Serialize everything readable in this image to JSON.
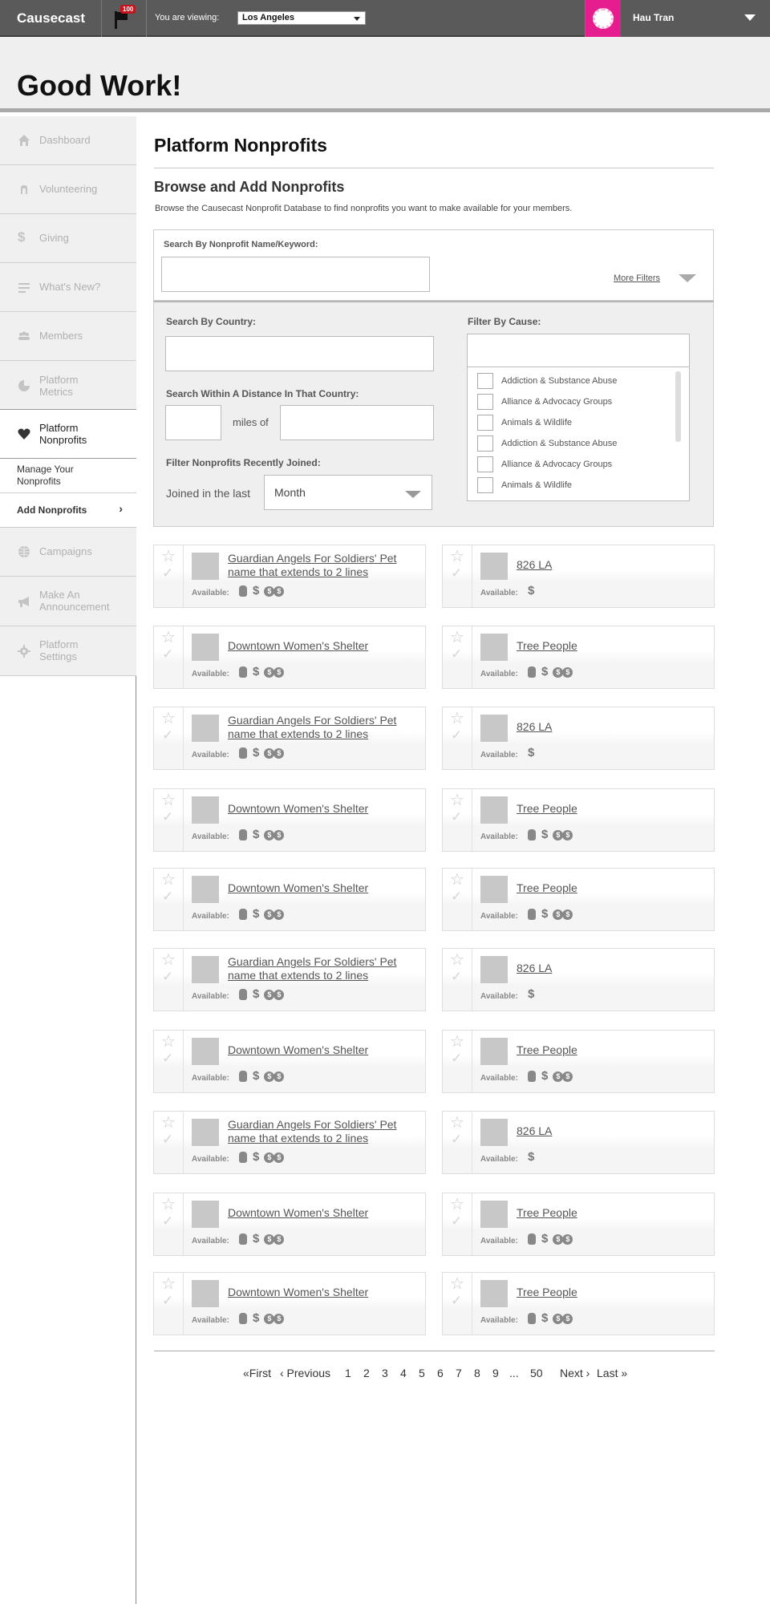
{
  "app": {
    "logo": "Causecast",
    "notification_count": "100"
  },
  "viewing": {
    "label": "You are viewing:",
    "city": "Los Angeles"
  },
  "user": {
    "name": "Hau Tran"
  },
  "header": {
    "title": "Good Work!"
  },
  "sidebar": {
    "items": [
      {
        "label": "Dashboard",
        "icon": "home-icon"
      },
      {
        "label": "Volunteering",
        "icon": "hand-icon"
      },
      {
        "label": "Giving",
        "icon": "dollar-icon"
      },
      {
        "label": "What's New?",
        "icon": "lines-icon"
      },
      {
        "label": "Members",
        "icon": "people-icon"
      },
      {
        "label": "Platform Metrics",
        "icon": "pie-chart-icon"
      },
      {
        "label": "Platform Nonprofits",
        "icon": "heart-icon"
      },
      {
        "label": "Campaigns",
        "icon": "globe-icon"
      },
      {
        "label": "Make An Announcement",
        "icon": "megaphone-icon"
      },
      {
        "label": "Platform Settings",
        "icon": "gear-icon"
      }
    ],
    "sub_items": [
      {
        "label": "Manage Your Nonprofits"
      },
      {
        "label": "Add Nonprofits",
        "chevron": "›"
      }
    ]
  },
  "main": {
    "title": "Platform Nonprofits",
    "section_title": "Browse and Add Nonprofits",
    "section_desc": "Browse the Causecast Nonprofit Database to find nonprofits you want to make available for your members."
  },
  "search": {
    "label": "Search By Nonprofit Name/Keyword:",
    "value": "",
    "more_filters": "More Filters"
  },
  "filters": {
    "country_label": "Search By Country:",
    "distance_label": "Search Within A Distance In That Country:",
    "miles_of": "miles of",
    "joined_label": "Filter Nonprofits Recently Joined:",
    "joined_text": "Joined in the last",
    "joined_period": "Month",
    "cause_label": "Filter By Cause:",
    "causes": [
      "Addiction & Substance Abuse",
      "Alliance & Advocacy Groups",
      "Animals & Wildlife",
      "Addiction & Substance Abuse",
      "Alliance & Advocacy Groups",
      "Animals & Wildlife"
    ]
  },
  "available_label": "Available:",
  "nonprofits": [
    {
      "name": "Guardian Angels For Soldiers' Pet name that extends to 2 lines",
      "options": [
        "volunteer",
        "donate",
        "match"
      ]
    },
    {
      "name": "826 LA",
      "options": [
        "donate"
      ]
    },
    {
      "name": "Downtown Women's Shelter",
      "options": [
        "volunteer",
        "donate",
        "match"
      ]
    },
    {
      "name": "Tree People",
      "options": [
        "volunteer",
        "donate",
        "match"
      ]
    },
    {
      "name": "Guardian Angels For Soldiers' Pet name that extends to 2 lines",
      "options": [
        "volunteer",
        "donate",
        "match"
      ]
    },
    {
      "name": "826 LA",
      "options": [
        "donate"
      ]
    },
    {
      "name": "Downtown Women's Shelter",
      "options": [
        "volunteer",
        "donate",
        "match"
      ]
    },
    {
      "name": "Tree People",
      "options": [
        "volunteer",
        "donate",
        "match"
      ]
    },
    {
      "name": "Downtown Women's Shelter",
      "options": [
        "volunteer",
        "donate",
        "match"
      ]
    },
    {
      "name": "Tree People",
      "options": [
        "volunteer",
        "donate",
        "match"
      ]
    },
    {
      "name": "Guardian Angels For Soldiers' Pet name that extends to 2 lines",
      "options": [
        "volunteer",
        "donate",
        "match"
      ]
    },
    {
      "name": "826 LA",
      "options": [
        "donate"
      ]
    },
    {
      "name": "Downtown Women's Shelter",
      "options": [
        "volunteer",
        "donate",
        "match"
      ]
    },
    {
      "name": "Tree People",
      "options": [
        "volunteer",
        "donate",
        "match"
      ]
    },
    {
      "name": "Guardian Angels For Soldiers' Pet name that extends to 2 lines",
      "options": [
        "volunteer",
        "donate",
        "match"
      ]
    },
    {
      "name": "826 LA",
      "options": [
        "donate"
      ]
    },
    {
      "name": "Downtown Women's Shelter",
      "options": [
        "volunteer",
        "donate",
        "match"
      ]
    },
    {
      "name": "Tree People",
      "options": [
        "volunteer",
        "donate",
        "match"
      ]
    },
    {
      "name": "Downtown Women's Shelter",
      "options": [
        "volunteer",
        "donate",
        "match"
      ]
    },
    {
      "name": "Tree People",
      "options": [
        "volunteer",
        "donate",
        "match"
      ]
    }
  ],
  "pagination": {
    "first": "«First",
    "previous": "‹ Previous",
    "pages": [
      "1",
      "2",
      "3",
      "4",
      "5",
      "6",
      "7",
      "8",
      "9"
    ],
    "ellipsis": "...",
    "last_page": "50",
    "next": "Next ›",
    "last": "Last »"
  },
  "colors": {
    "brand_pink": "#e61d8f",
    "topbar": "#5a5a5a",
    "badge_red": "#c4141c"
  }
}
